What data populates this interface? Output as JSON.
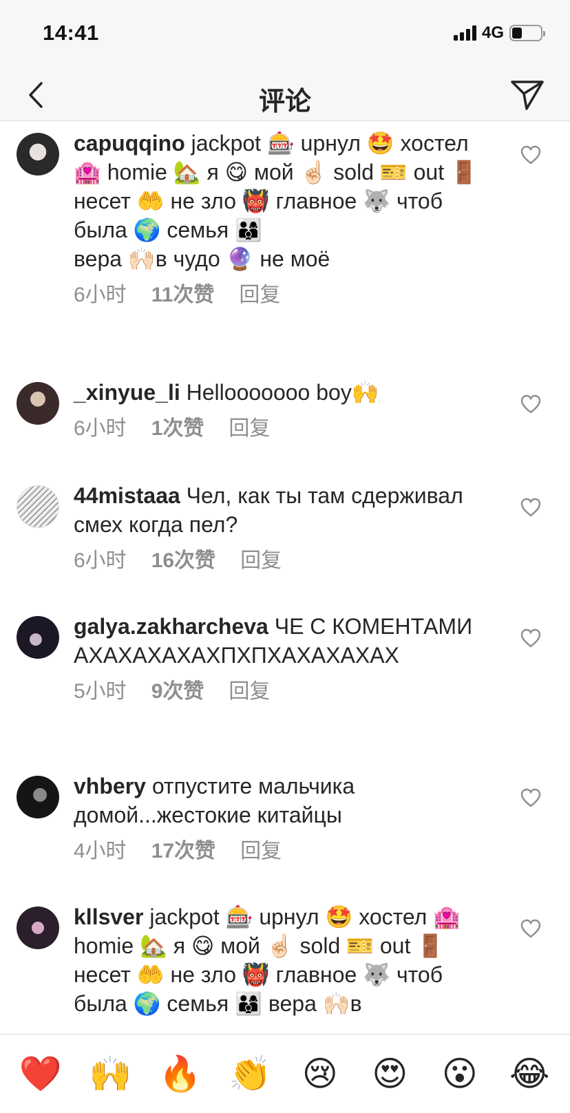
{
  "status": {
    "time": "14:41",
    "network": "4G",
    "battery_level": 0.35
  },
  "nav": {
    "title": "评论",
    "back_icon": "chevron-left-icon",
    "share_icon": "paper-plane-icon"
  },
  "comments": [
    {
      "username": "capuqqino",
      "text": " jackpot 🎰 uрнул 🤩 хостел 🏩 homie 🏡 я 😋 мой ☝🏻 sold 🎫 out 🚪 несет 🤲 не зло 👹 главное 🐺 чтоб была 🌍 семья 👨‍👩‍👦",
      "text2": "вера 🙌🏻в чудо 🔮 не моё",
      "time": "6小时",
      "likes": "11次赞",
      "reply": "回复"
    },
    {
      "username": "_xinyue_li",
      "text": " Hellooooooo boy🙌",
      "time": "6小时",
      "likes": "1次赞",
      "reply": "回复"
    },
    {
      "username": "44mistaaa",
      "text": " Чел, как ты там сдерживал смех когда пел?",
      "time": "6小时",
      "likes": "16次赞",
      "reply": "回复"
    },
    {
      "username": "galya.zakharcheva",
      "text": " ЧЕ С КОМЕНТАМИ АХАХАХАХАХПХПХАХАХАХАХ",
      "time": "5小时",
      "likes": "9次赞",
      "reply": "回复"
    },
    {
      "username": "vhbery",
      "text": " отпустите мальчика домой...жестокие китайцы",
      "time": "4小时",
      "likes": "17次赞",
      "reply": "回复"
    },
    {
      "username": "kllsver",
      "text": " jackpot 🎰 uрнул 🤩 хостел 🏩 homie 🏡 я 😋 мой ☝🏻 sold 🎫 out 🚪 несет 🤲 не зло 👹 главное 🐺 чтоб была 🌍 семья 👨‍👩‍👦 вера 🙌🏻в",
      "time": "",
      "likes": "",
      "reply": ""
    }
  ],
  "quick_reactions": [
    "❤️",
    "🙌",
    "🔥",
    "👏",
    "😢",
    "😍",
    "😮",
    "😂"
  ],
  "colors": {
    "text": "#262626",
    "meta": "#8e8e8e",
    "bar_bg": "#f7f7f7",
    "divider": "#dbdbdb"
  }
}
